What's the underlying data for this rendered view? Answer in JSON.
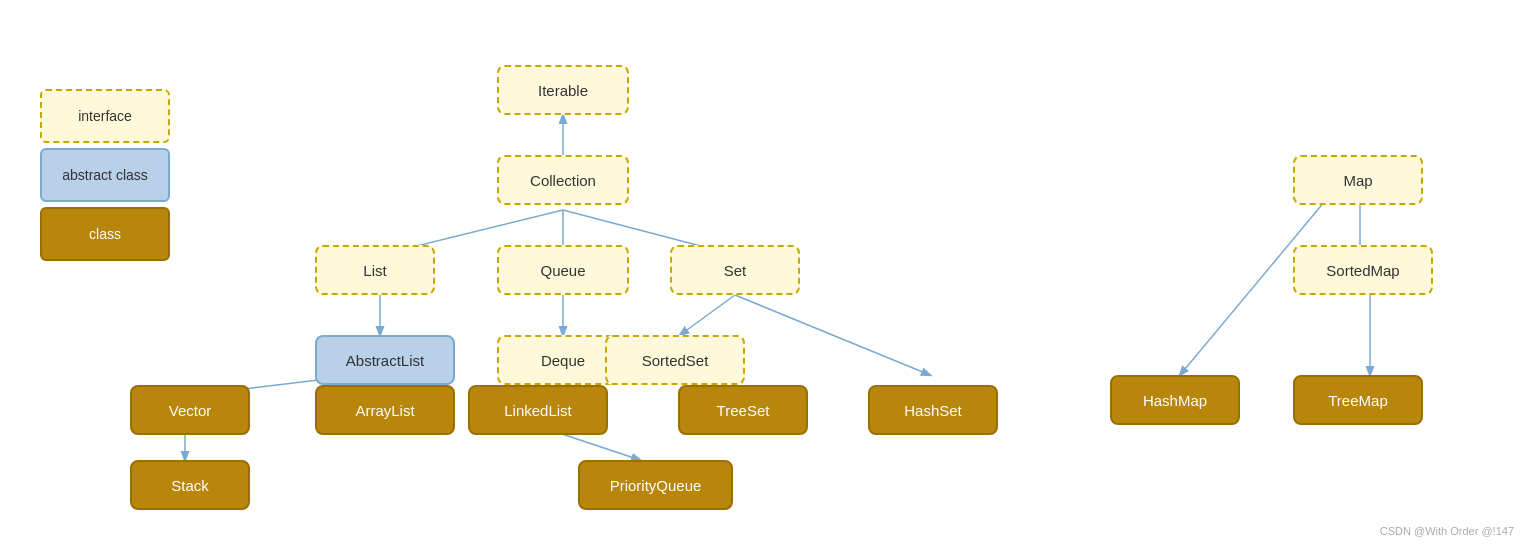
{
  "legend": {
    "interface_label": "interface",
    "abstract_label": "abstract class",
    "class_label": "class"
  },
  "nodes": {
    "iterable": "Iterable",
    "collection": "Collection",
    "list": "List",
    "queue": "Queue",
    "set": "Set",
    "abstractList": "AbstractList",
    "deque": "Deque",
    "sortedSet": "SortedSet",
    "vector": "Vector",
    "arrayList": "ArrayList",
    "linkedList": "LinkedList",
    "treeSet": "TreeSet",
    "hashSet": "HashSet",
    "stack": "Stack",
    "priorityQueue": "PriorityQueue",
    "map": "Map",
    "sortedMap": "SortedMap",
    "hashMap": "HashMap",
    "treeMap": "TreeMap"
  },
  "watermark": "CSDN @With Order @!147"
}
